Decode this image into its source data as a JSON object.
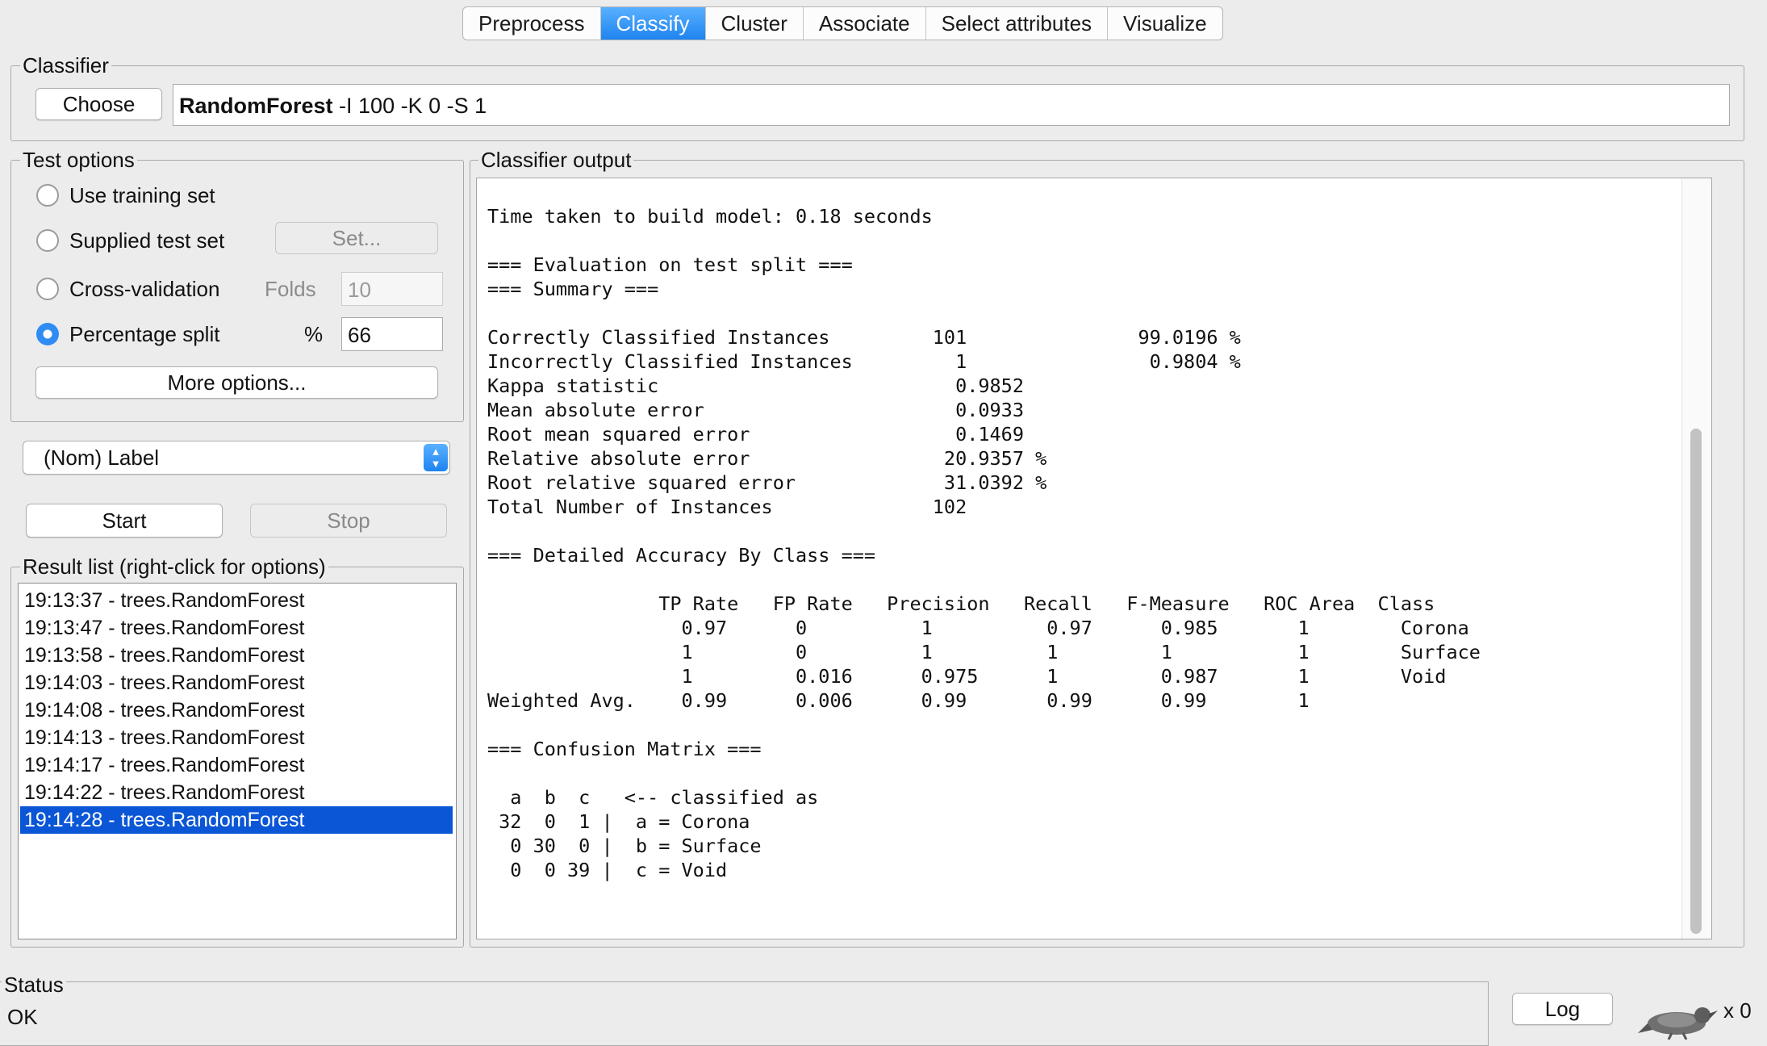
{
  "tabs": [
    "Preprocess",
    "Classify",
    "Cluster",
    "Associate",
    "Select attributes",
    "Visualize"
  ],
  "active_tab": "Classify",
  "classifier": {
    "legend": "Classifier",
    "choose_label": "Choose",
    "name": "RandomForest",
    "options": "-I 100 -K 0 -S 1"
  },
  "test_options": {
    "legend": "Test options",
    "use_training_set": "Use training set",
    "supplied_test_set": "Supplied test set",
    "set_button": "Set...",
    "cross_validation": "Cross-validation",
    "folds_label": "Folds",
    "folds_value": "10",
    "percentage_split": "Percentage split",
    "percent_label": "%",
    "percent_value": "66",
    "more_options": "More options...",
    "selected": "percentage_split"
  },
  "class_select": {
    "value": "(Nom) Label"
  },
  "run": {
    "start": "Start",
    "stop": "Stop"
  },
  "result_list": {
    "legend": "Result list (right-click for options)",
    "items": [
      "19:13:37 - trees.RandomForest",
      "19:13:47 - trees.RandomForest",
      "19:13:58 - trees.RandomForest",
      "19:14:03 - trees.RandomForest",
      "19:14:08 - trees.RandomForest",
      "19:14:13 - trees.RandomForest",
      "19:14:17 - trees.RandomForest",
      "19:14:22 - trees.RandomForest",
      "19:14:28 - trees.RandomForest"
    ],
    "selected_index": 8
  },
  "output": {
    "legend": "Classifier output",
    "lines": [
      "Time taken to build model: 0.18 seconds",
      "",
      "=== Evaluation on test split ===",
      "=== Summary ===",
      "",
      "Correctly Classified Instances         101               99.0196 %",
      "Incorrectly Classified Instances         1                0.9804 %",
      "Kappa statistic                          0.9852",
      "Mean absolute error                      0.0933",
      "Root mean squared error                  0.1469",
      "Relative absolute error                 20.9357 %",
      "Root relative squared error             31.0392 %",
      "Total Number of Instances              102",
      "",
      "=== Detailed Accuracy By Class ===",
      "",
      "               TP Rate   FP Rate   Precision   Recall   F-Measure   ROC Area  Class",
      "                 0.97      0          1          0.97      0.985       1        Corona",
      "                 1         0          1          1         1           1        Surface",
      "                 1         0.016      0.975      1         0.987       1        Void",
      "Weighted Avg.    0.99      0.006      0.99       0.99      0.99        1",
      "",
      "=== Confusion Matrix ===",
      "",
      "  a  b  c   <-- classified as",
      " 32  0  1 |  a = Corona",
      "  0 30  0 |  b = Surface",
      "  0  0 39 |  c = Void"
    ]
  },
  "status": {
    "legend": "Status",
    "text": "OK",
    "log_button": "Log",
    "task_count": "x 0"
  }
}
